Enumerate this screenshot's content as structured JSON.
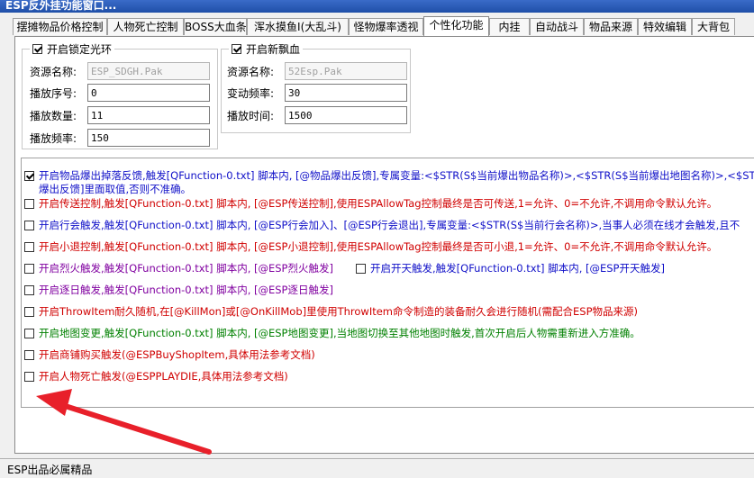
{
  "window": {
    "title": "ESP反外挂功能窗口..."
  },
  "tabs": [
    {
      "label": "摆摊物品价格控制",
      "active": false
    },
    {
      "label": "人物死亡控制",
      "active": false
    },
    {
      "label": "BOSS大血条",
      "active": false
    },
    {
      "label": "浑水摸鱼I(大乱斗)",
      "active": false
    },
    {
      "label": "怪物爆率透视",
      "active": false
    },
    {
      "label": "个性化功能",
      "active": true
    },
    {
      "label": "内挂",
      "active": false
    },
    {
      "label": "自动战斗",
      "active": false
    },
    {
      "label": "物品来源",
      "active": false
    },
    {
      "label": "特效编辑",
      "active": false
    },
    {
      "label": "大背包",
      "active": false
    }
  ],
  "lock_ring": {
    "title": "开启锁定光环",
    "checked": true,
    "fields": [
      {
        "label": "资源名称:",
        "value": "ESP_SDGH.Pak",
        "disabled": true
      },
      {
        "label": "播放序号:",
        "value": "0",
        "disabled": false
      },
      {
        "label": "播放数量:",
        "value": "11",
        "disabled": false
      },
      {
        "label": "播放频率:",
        "value": "150",
        "disabled": false
      }
    ]
  },
  "new_blood": {
    "title": "开启新飘血",
    "checked": true,
    "fields": [
      {
        "label": "资源名称:",
        "value": "52Esp.Pak",
        "disabled": true
      },
      {
        "label": "变动频率:",
        "value": "30",
        "disabled": false
      },
      {
        "label": "播放时间:",
        "value": "1500",
        "disabled": false
      }
    ]
  },
  "options": {
    "drop_feedback": {
      "checked": true,
      "line1": "开启物品爆出掉落反馈,触发[QFunction-0.txt] 脚本内, [@物品爆出反馈],专属变量:<$STR(S$当前爆出物品名称)>,<$STR(S$当前爆出地图名称)>,<$ST",
      "line2": "爆出反馈]里面取值,否则不准确。"
    },
    "teleport": {
      "checked": false,
      "text": "开启传送控制,触发[QFunction-0.txt] 脚本内, [@ESP传送控制],使用ESPAllowTag控制最终是否可传送,1=允许、0=不允许,不调用命令默认允许。"
    },
    "guild": {
      "checked": false,
      "text": "开启行会触发,触发[QFunction-0.txt] 脚本内, [@ESP行会加入]、[@ESP行会退出],专属变量:<$STR(S$当前行会名称)>,当事人必须在线才会触发,且不"
    },
    "logout": {
      "checked": false,
      "text": "开启小退控制,触发[QFunction-0.txt] 脚本内, [@ESP小退控制],使用ESPAllowTag控制最终是否可小退,1=允许、0=不允许,不调用命令默认允许。"
    },
    "fire": {
      "checked": false,
      "text": "开启烈火触发,触发[QFunction-0.txt] 脚本内, [@ESP烈火触发]"
    },
    "sky": {
      "checked": false,
      "text": "开启开天触发,触发[QFunction-0.txt] 脚本内, [@ESP开天触发]"
    },
    "sun": {
      "checked": false,
      "text": "开启逐日触发,触发[QFunction-0.txt] 脚本内, [@ESP逐日触发]"
    },
    "throw": {
      "checked": false,
      "text": "开启ThrowItem耐久随机,在[@KillMon]或[@OnKillMob]里使用ThrowItem命令制造的装备耐久会进行随机(需配合ESP物品来源)"
    },
    "map": {
      "checked": false,
      "text": "开启地图变更,触发[QFunction-0.txt] 脚本内, [@ESP地图变更],当地图切换至其他地图时触发,首次开启后人物需重新进入方准确。"
    },
    "shop": {
      "checked": false,
      "text": "开启商铺购买触发(@ESPBuyShopItem,具体用法参考文档)"
    },
    "death": {
      "checked": false,
      "text": "开启人物死亡触发(@ESPPLAYDIE,具体用法参考文档)"
    }
  },
  "status": {
    "text": "ESP出品必属精品"
  },
  "colors": {
    "arrow": "#e8202a",
    "blue": "#1010c8",
    "red": "#d00000",
    "green": "#008000",
    "purple": "#8000a0"
  }
}
